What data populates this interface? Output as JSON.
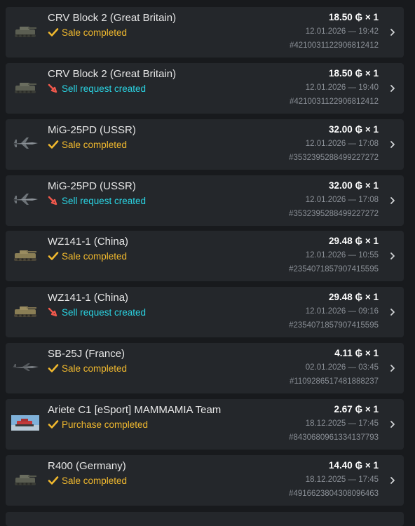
{
  "currency_symbol": "₲",
  "colors": {
    "background": "#181a1d",
    "row_background": "#24272b",
    "completed": "#f1b92e",
    "created": "#2ad4e3",
    "created_icon": "#f0584c",
    "muted_text": "#8a8f96"
  },
  "transactions": [
    {
      "title": "CRV Block 2 (Great Britain)",
      "status": "Sale completed",
      "status_type": "completed",
      "price": "18.50",
      "qty": "× 1",
      "date": "12.01.2026 — 19:42",
      "order_id": "#421003112290681241​2",
      "thumb": "tank"
    },
    {
      "title": "CRV Block 2 (Great Britain)",
      "status": "Sell request created",
      "status_type": "created",
      "price": "18.50",
      "qty": "× 1",
      "date": "12.01.2026 — 19:40",
      "order_id": "#4210031122906812412",
      "thumb": "tank"
    },
    {
      "title": "MiG-25PD (USSR)",
      "status": "Sale completed",
      "status_type": "completed",
      "price": "32.00",
      "qty": "× 1",
      "date": "12.01.2026 — 17:08",
      "order_id": "#3532395288499227272",
      "thumb": "jet"
    },
    {
      "title": "MiG-25PD (USSR)",
      "status": "Sell request created",
      "status_type": "created",
      "price": "32.00",
      "qty": "× 1",
      "date": "12.01.2026 — 17:08",
      "order_id": "#3532395288499227272",
      "thumb": "jet"
    },
    {
      "title": "WZ141-1 (China)",
      "status": "Sale completed",
      "status_type": "completed",
      "price": "29.48",
      "qty": "× 1",
      "date": "12.01.2026 — 10:55",
      "order_id": "#2354071857907415595",
      "thumb": "tank-tan"
    },
    {
      "title": "WZ141-1 (China)",
      "status": "Sell request created",
      "status_type": "created",
      "price": "29.48",
      "qty": "× 1",
      "date": "12.01.2026 — 09:16",
      "order_id": "#2354071857907415595",
      "thumb": "tank-tan"
    },
    {
      "title": "SB-25J (France)",
      "status": "Sale completed",
      "status_type": "completed",
      "price": "4.11",
      "qty": "× 1",
      "date": "02.01.2026 — 03:45",
      "order_id": "#1109286517481888237",
      "thumb": "jet-dark"
    },
    {
      "title": "Ariete C1 [eSport] MAMMAMIA Team",
      "status": "Purchase completed",
      "status_type": "completed",
      "price": "2.67",
      "qty": "× 1",
      "date": "18.12.2025 — 17:45",
      "order_id": "#8430680961334137793",
      "thumb": "card"
    },
    {
      "title": "R400 (Germany)",
      "status": "Sale completed",
      "status_type": "completed",
      "price": "14.40",
      "qty": "× 1",
      "date": "18.12.2025 — 17:45",
      "order_id": "#4916623804308096463",
      "thumb": "tank"
    }
  ]
}
